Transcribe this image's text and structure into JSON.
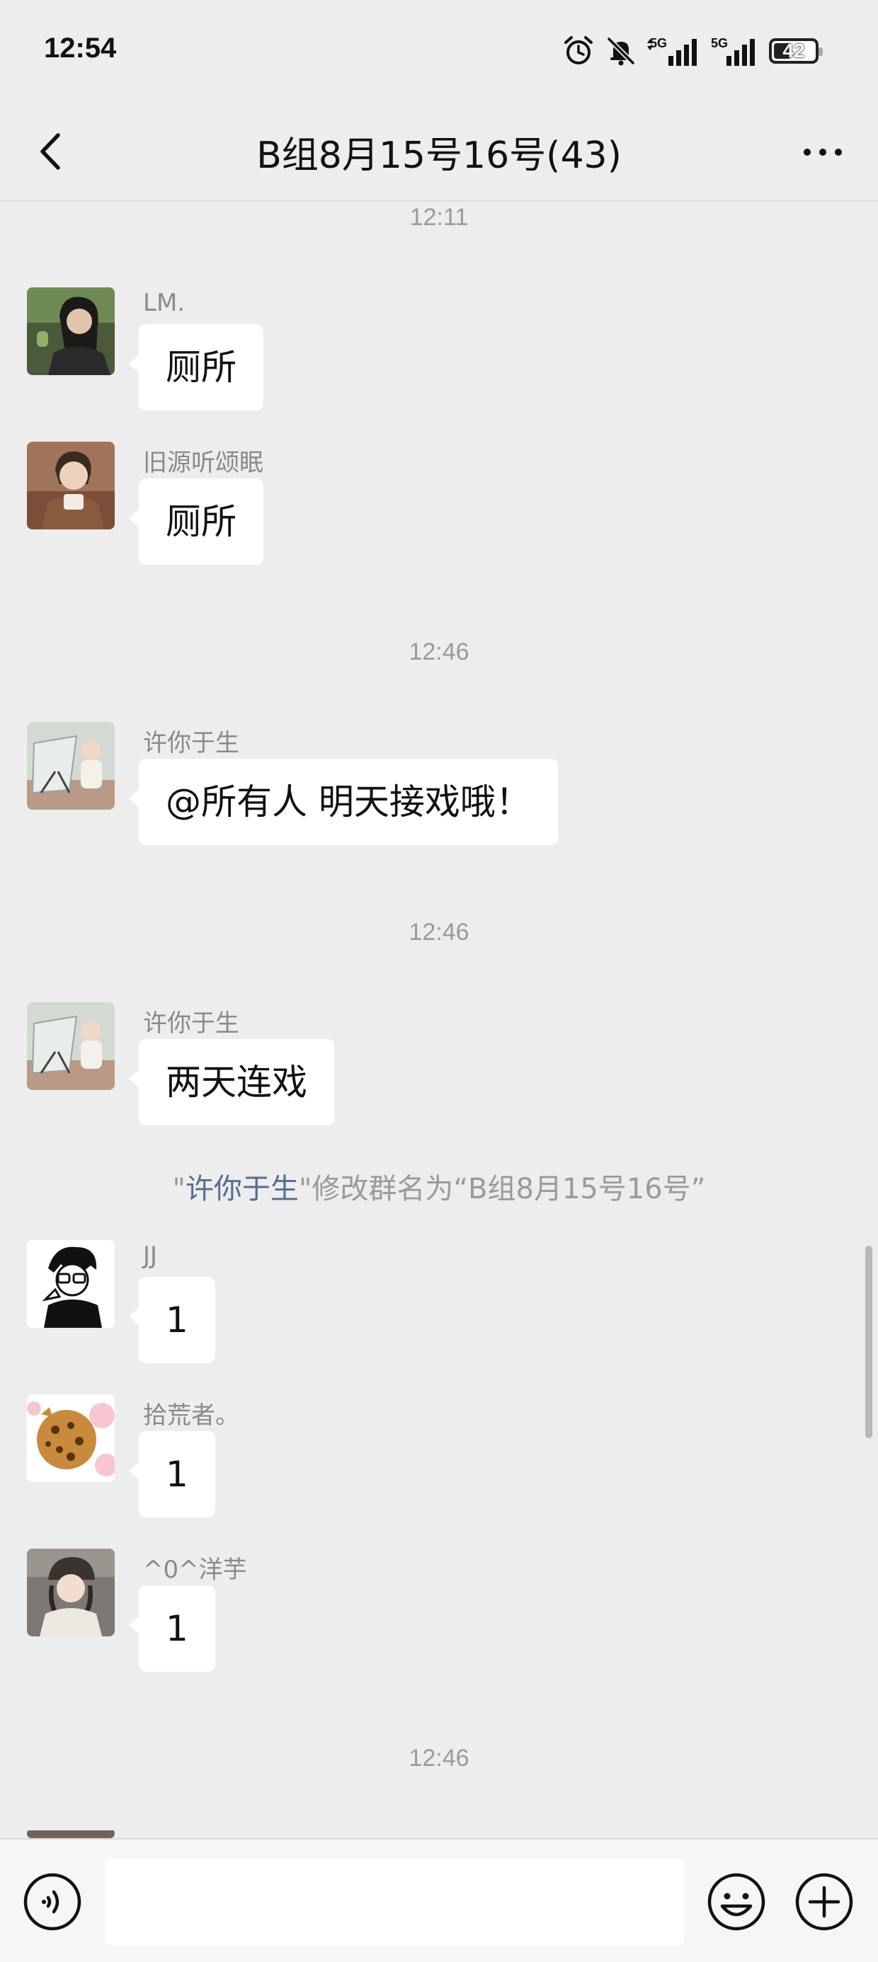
{
  "status_bar": {
    "time": "12:54",
    "network_1": "5G",
    "network_2": "5G",
    "battery": "42"
  },
  "header": {
    "title": "B组8月15号16号(43)"
  },
  "chat": {
    "timestamps": [
      "12:11",
      "12:46",
      "12:46",
      "12:46"
    ],
    "messages": [
      {
        "sender": "LM.",
        "text": "厕所"
      },
      {
        "sender": "旧源听颂眠",
        "text": "厕所"
      },
      {
        "sender": "许你于生",
        "text": "@所有人  明天接戏哦！"
      },
      {
        "sender": "许你于生",
        "text": "两天连戏"
      },
      {
        "sender": "JJ",
        "text": "1"
      },
      {
        "sender": "拾荒者。",
        "text": "1"
      },
      {
        "sender": "^0^洋芋",
        "text": "1"
      }
    ],
    "system_notice": {
      "quote_open": "\"",
      "name": "许你于生",
      "text": "\"修改群名为“B组8月15号16号”"
    }
  },
  "input_bar": {
    "placeholder": ""
  },
  "icons": {
    "back": "chevron-left-icon",
    "more": "more-dots-icon",
    "voice": "voice-icon",
    "emoji": "emoji-icon",
    "plus": "plus-icon",
    "alarm": "alarm-icon",
    "mute": "bell-muted-icon"
  },
  "colors": {
    "background": "#ededed",
    "bubble": "#ffffff",
    "link_name": "#576b95",
    "muted_text": "#9a9a9a"
  }
}
